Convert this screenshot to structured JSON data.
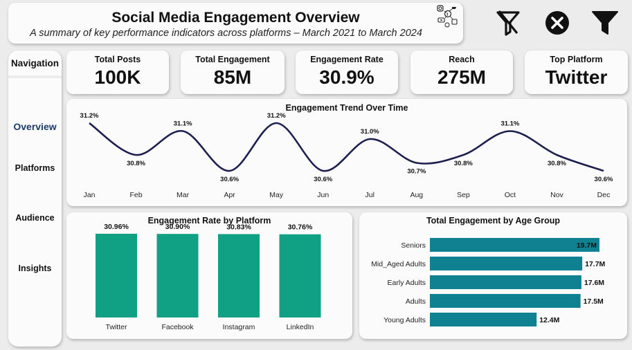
{
  "header": {
    "title": "Social Media Engagement Overview",
    "subtitle": "A summary of key performance indicators across platforms – March 2021 to March 2024"
  },
  "toolbar": {
    "icons": [
      "clear-filter-icon",
      "close-icon",
      "filter-icon"
    ]
  },
  "navigation": {
    "title": "Navigation",
    "items": [
      {
        "label": "Overview",
        "active": true
      },
      {
        "label": "Platforms",
        "active": false
      },
      {
        "label": "Audience",
        "active": false
      },
      {
        "label": "Insights",
        "active": false
      }
    ]
  },
  "kpis": [
    {
      "label": "Total Posts",
      "value": "100K"
    },
    {
      "label": "Total Engagement",
      "value": "85M"
    },
    {
      "label": "Engagement Rate",
      "value": "30.9%"
    },
    {
      "label": "Reach",
      "value": "275M"
    },
    {
      "label": "Top Platform",
      "value": "Twitter"
    }
  ],
  "colors": {
    "line": "#1c1f4f",
    "platform_bars": "#10a084",
    "age_bars": "#0f8190",
    "active_nav": "#1b3a68"
  },
  "chart_data": [
    {
      "type": "line",
      "title": "Engagement Trend Over Time",
      "categories": [
        "Jan",
        "Feb",
        "Mar",
        "Apr",
        "May",
        "Jun",
        "Jul",
        "Aug",
        "Sep",
        "Oct",
        "Nov",
        "Dec"
      ],
      "values": [
        31.2,
        30.8,
        31.1,
        30.6,
        31.2,
        30.6,
        31.0,
        30.7,
        30.8,
        31.1,
        30.8,
        30.6
      ],
      "labels": [
        "31.2%",
        "30.8%",
        "31.1%",
        "30.6%",
        "31.2%",
        "30.6%",
        "31.0%",
        "30.7%",
        "30.8%",
        "31.1%",
        "30.8%",
        "30.6%"
      ]
    },
    {
      "type": "bar",
      "title": "Engagement Rate by Platform",
      "categories": [
        "Twitter",
        "Facebook",
        "Instagram",
        "LinkedIn"
      ],
      "values": [
        30.96,
        30.9,
        30.83,
        30.76
      ],
      "labels": [
        "30.96%",
        "30.90%",
        "30.83%",
        "30.76%"
      ]
    },
    {
      "type": "bar",
      "orientation": "horizontal",
      "title": "Total Engagement by Age Group",
      "categories": [
        "Seniors",
        "Mid_Aged Adults",
        "Early Adults",
        "Adults",
        "Young Adults"
      ],
      "values": [
        19.7,
        17.7,
        17.6,
        17.5,
        12.4
      ],
      "labels": [
        "19.7M",
        "17.7M",
        "17.6M",
        "17.5M",
        "12.4M"
      ]
    }
  ]
}
